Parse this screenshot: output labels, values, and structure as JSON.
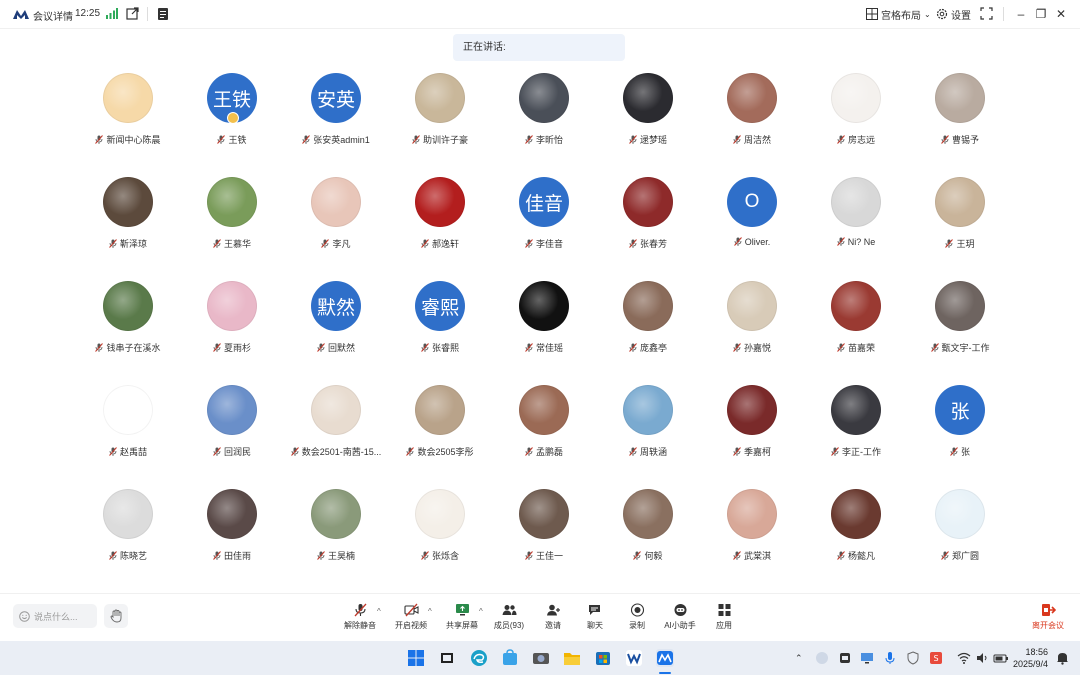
{
  "topbar": {
    "title": "会议详情",
    "time": "12:25",
    "layout_label": "宫格布局",
    "settings_label": "设置"
  },
  "speaking": {
    "label": "正在讲话:"
  },
  "participants": [
    {
      "name": "新闻中心陈晨",
      "avatar": "photo",
      "color": "#f6d9a8"
    },
    {
      "name": "王铁",
      "avatar": "text",
      "text": "王铁",
      "host": true
    },
    {
      "name": "张安英admin1",
      "avatar": "text",
      "text": "安英"
    },
    {
      "name": "助训许子豪",
      "avatar": "photo",
      "color": "#c9b79a"
    },
    {
      "name": "李昕怡",
      "avatar": "photo",
      "color": "#4a4f58"
    },
    {
      "name": "逯梦瑶",
      "avatar": "photo",
      "color": "#2b2b30"
    },
    {
      "name": "周洁然",
      "avatar": "photo",
      "color": "#a36b5b"
    },
    {
      "name": "房志远",
      "avatar": "photo",
      "color": "#f4f1ee"
    },
    {
      "name": "曹锡予",
      "avatar": "photo",
      "color": "#b9aba0"
    },
    {
      "name": "靳泽琼",
      "avatar": "photo",
      "color": "#5c4a3c"
    },
    {
      "name": "王慕华",
      "avatar": "photo",
      "color": "#7a9c5a"
    },
    {
      "name": "李凡",
      "avatar": "photo",
      "color": "#e8c6b9"
    },
    {
      "name": "郝逸轩",
      "avatar": "photo",
      "color": "#b31e1e"
    },
    {
      "name": "李佳音",
      "avatar": "text",
      "text": "佳音"
    },
    {
      "name": "张春芳",
      "avatar": "photo",
      "color": "#8e2a2a"
    },
    {
      "name": "Oliver.",
      "avatar": "text",
      "text": "O"
    },
    {
      "name": "Ni? Ne",
      "avatar": "photo",
      "color": "#d8d8d8"
    },
    {
      "name": "王玥",
      "avatar": "photo",
      "color": "#c9b49a"
    },
    {
      "name": "钱串子在溪水",
      "avatar": "photo",
      "color": "#5a7a4a"
    },
    {
      "name": "夏雨杉",
      "avatar": "photo",
      "color": "#e9b8c8"
    },
    {
      "name": "回默然",
      "avatar": "text",
      "text": "默然"
    },
    {
      "name": "张睿熙",
      "avatar": "text",
      "text": "睿熙"
    },
    {
      "name": "常佳瑶",
      "avatar": "photo",
      "color": "#111111"
    },
    {
      "name": "庞鑫亭",
      "avatar": "photo",
      "color": "#8a6b5a"
    },
    {
      "name": "孙嘉悦",
      "avatar": "photo",
      "color": "#d8cbb8"
    },
    {
      "name": "苗嘉荣",
      "avatar": "photo",
      "color": "#9a3a32"
    },
    {
      "name": "甄文宇-工作",
      "avatar": "photo",
      "color": "#6e6460"
    },
    {
      "name": "赵禹喆",
      "avatar": "photo",
      "color": "#ffffff"
    },
    {
      "name": "回润民",
      "avatar": "photo",
      "color": "#6a8fc9"
    },
    {
      "name": "数会2501-南茜-15...",
      "avatar": "photo",
      "color": "#e8dcd0"
    },
    {
      "name": "数会2505李彤",
      "avatar": "photo",
      "color": "#b9a38a"
    },
    {
      "name": "孟鹏磊",
      "avatar": "photo",
      "color": "#9b6a55"
    },
    {
      "name": "周轶涵",
      "avatar": "photo",
      "color": "#7aaad0"
    },
    {
      "name": "季嘉柯",
      "avatar": "photo",
      "color": "#7a2a2a"
    },
    {
      "name": "李正-工作",
      "avatar": "photo",
      "color": "#3a3a40"
    },
    {
      "name": "张",
      "avatar": "text",
      "text": "张"
    },
    {
      "name": "陈晓艺",
      "avatar": "photo",
      "color": "#dcdcdc"
    },
    {
      "name": "田佳雨",
      "avatar": "photo",
      "color": "#5a4a48"
    },
    {
      "name": "王昊楠",
      "avatar": "photo",
      "color": "#8a9a7a"
    },
    {
      "name": "张烁含",
      "avatar": "photo",
      "color": "#f4efe8"
    },
    {
      "name": "王佳一",
      "avatar": "photo",
      "color": "#6e5a4e"
    },
    {
      "name": "何毅",
      "avatar": "photo",
      "color": "#8a7060"
    },
    {
      "name": "武棠淇",
      "avatar": "photo",
      "color": "#d8a898"
    },
    {
      "name": "杨懿凡",
      "avatar": "photo",
      "color": "#6a3a30"
    },
    {
      "name": "郑广圆",
      "avatar": "photo",
      "color": "#e8f2f8"
    }
  ],
  "bottombar": {
    "chat_placeholder": "说点什么...",
    "tools": [
      {
        "label": "解除静音",
        "icon": "mic-muted-icon",
        "caret": true
      },
      {
        "label": "开启视频",
        "icon": "video-off-icon",
        "caret": true
      },
      {
        "label": "共享屏幕",
        "icon": "share-screen-icon",
        "caret": true
      },
      {
        "label": "成员(93)",
        "icon": "members-icon"
      },
      {
        "label": "邀请",
        "icon": "invite-icon"
      },
      {
        "label": "聊天",
        "icon": "chat-icon"
      },
      {
        "label": "录制",
        "icon": "record-icon"
      },
      {
        "label": "AI小助手",
        "icon": "ai-assistant-icon"
      },
      {
        "label": "应用",
        "icon": "apps-icon"
      }
    ],
    "leave_label": "离开会议"
  },
  "taskbar": {
    "time": "18:56",
    "date": "2025/9/4"
  },
  "colors": {
    "accent": "#2f6fc9",
    "leave": "#d9381e",
    "muted_mic": "#c0392b"
  }
}
